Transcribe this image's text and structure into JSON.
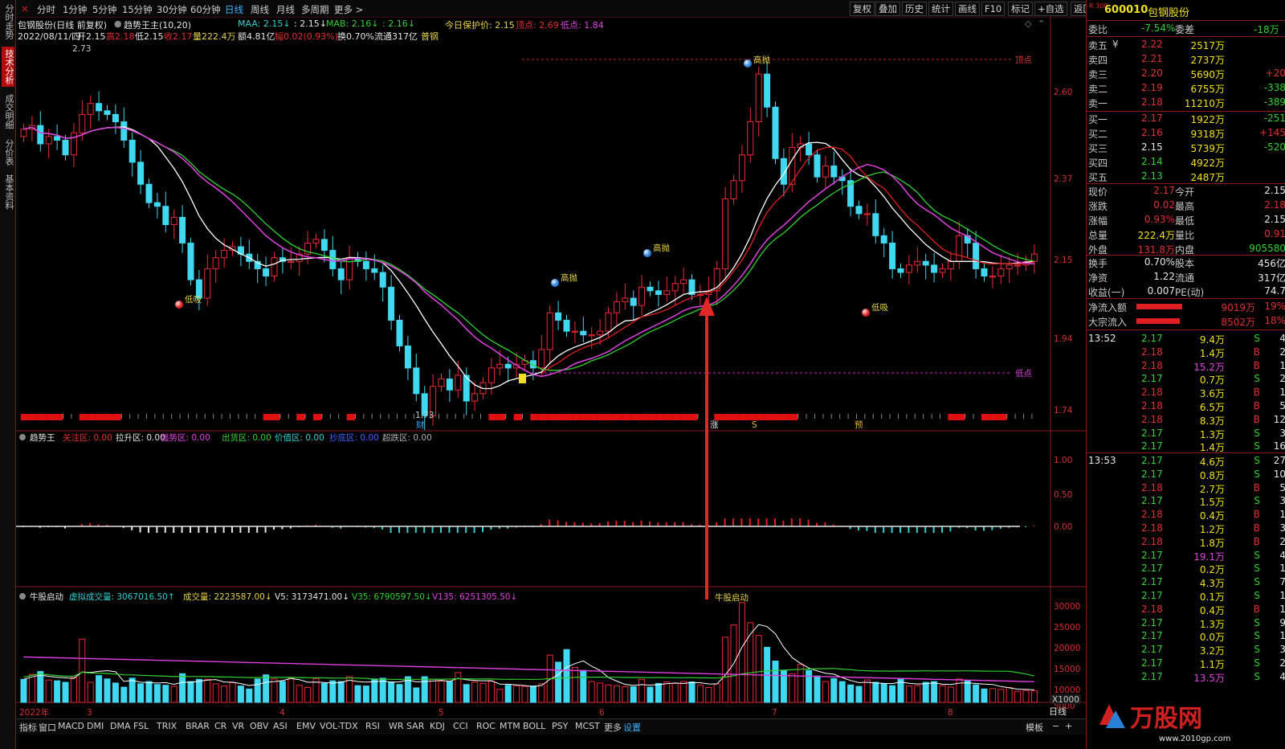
{
  "side_tabs": [
    "分时走势",
    "技术分析",
    "成交明细",
    "分价表",
    "基本资料"
  ],
  "periods": [
    "分时",
    "1分钟",
    "5分钟",
    "15分钟",
    "30分钟",
    "60分钟",
    "日线",
    "周线",
    "月线",
    "多周期",
    "更多 >"
  ],
  "tools": [
    "复权",
    "叠加",
    "历史",
    "统计",
    "画线",
    "F10",
    "标记",
    "+自选",
    "返回"
  ],
  "info": {
    "title": "包钢股份(日线 前复权)",
    "indicator": "趋势王主(10,20)",
    "maa": "MAA: 2.15↓",
    "mid": ": 2.15↓",
    "mab": "MAB: 2.16↓",
    "mac": ": 2.16↓",
    "protect": "今日保护价: 2.15",
    "top": "顶点: 2.69",
    "bottom": "低点: 1.84",
    "date": "2022/08/11/四",
    "open": "开2.15",
    "high": "高2.18",
    "low": "低2.15",
    "close": "收2.17",
    "vol": "量222.4万",
    "amt": "额4.81亿",
    "chg": "幅0.02(0.93%)",
    "turn": "换0.70%",
    "flow": "流通317亿",
    "cat": "普钢"
  },
  "price_axis": [
    "2.60",
    "2.37",
    "2.15",
    "1.94",
    "1.74"
  ],
  "annotations": {
    "high_mark": "2.73",
    "low_mark": "1.73",
    "top_label": "顶点",
    "bottom_label": "低点",
    "sell1": "高抛",
    "sell2": "高抛",
    "sell3": "高抛",
    "buy1": "低吸",
    "buy2": "低吸",
    "tag_cai": "财",
    "tag_zhang": "涨",
    "tag_s": "S",
    "tag_yu": "预"
  },
  "panel2": {
    "name": "趋势王",
    "items": [
      "关注区: 0.00",
      "拉升区: 0.00",
      "强势区: 0.00",
      "出货区: 0.00",
      "价值区: 0.00",
      "抄底区: 0.00",
      "超跌区: 0.00"
    ],
    "colors": [
      "#e03030",
      "#e6e6e6",
      "#e040e0",
      "#30d030",
      "#30d0d0",
      "#4060ff",
      "#b0b0b0"
    ],
    "axis": [
      "1.00",
      "0.50",
      "0.00"
    ]
  },
  "panel3": {
    "name": "牛股启动",
    "virt": "虚拟成交量: 3067016.50↑",
    "vol": "成交量: 2223587.00↓",
    "v5": "V5: 3173471.00↓",
    "v35": "V35: 6790597.50↓",
    "v135": "V135: 6251305.50↓",
    "axis": [
      "30000",
      "25000",
      "20000",
      "15000",
      "10000",
      "5000"
    ],
    "unit": "X1000",
    "marker": "牛股启动"
  },
  "date_axis": [
    "2022年",
    "3",
    "4",
    "5",
    "6",
    "7",
    "8"
  ],
  "bottom_tabs": [
    "指标",
    "窗口",
    "MACD",
    "DMI",
    "DMA",
    "FSL",
    "TRIX",
    "BRAR",
    "CR",
    "VR",
    "OBV",
    "ASI",
    "EMV",
    "VOL-TDX",
    "RSI",
    "WR",
    "SAR",
    "KDJ",
    "CCI",
    "ROC",
    "MTM",
    "BOLL",
    "PSY",
    "MCST",
    "更多",
    "设置"
  ],
  "bottom_right": [
    "日线",
    "模板"
  ],
  "stock": {
    "code": "600010",
    "name": "包钢股份",
    "badge": "R 300"
  },
  "wei": {
    "label1": "委比",
    "v1": "-7.54%",
    "label2": "委差",
    "v2": "-18万"
  },
  "sell_orders": [
    {
      "label": "卖五",
      "flag": "¥",
      "price": "2.22",
      "vol": "2517万",
      "chg": ""
    },
    {
      "label": "卖四",
      "flag": "",
      "price": "2.21",
      "vol": "2737万",
      "chg": ""
    },
    {
      "label": "卖三",
      "flag": "",
      "price": "2.20",
      "vol": "5690万",
      "chg": "+20"
    },
    {
      "label": "卖二",
      "flag": "",
      "price": "2.19",
      "vol": "6755万",
      "chg": "-338"
    },
    {
      "label": "卖一",
      "flag": "",
      "price": "2.18",
      "vol": "11210万",
      "chg": "-389"
    }
  ],
  "buy_orders": [
    {
      "label": "买一",
      "price": "2.17",
      "vol": "1922万",
      "chg": "-251"
    },
    {
      "label": "买二",
      "price": "2.16",
      "vol": "9318万",
      "chg": "+145"
    },
    {
      "label": "买三",
      "price": "2.15",
      "vol": "5739万",
      "chg": "-520"
    },
    {
      "label": "买四",
      "price": "2.14",
      "vol": "4922万",
      "chg": ""
    },
    {
      "label": "买五",
      "price": "2.13",
      "vol": "2487万",
      "chg": ""
    }
  ],
  "quote": [
    {
      "l1": "现价",
      "v1": "2.17",
      "l2": "今开",
      "v2": "2.15"
    },
    {
      "l1": "涨跌",
      "v1": "0.02",
      "l2": "最高",
      "v2": "2.18"
    },
    {
      "l1": "涨幅",
      "v1": "0.93%",
      "l2": "最低",
      "v2": "2.15"
    },
    {
      "l1": "总量",
      "v1": "222.4万",
      "l2": "量比",
      "v2": "0.91"
    },
    {
      "l1": "外盘",
      "v1": "131.8万",
      "l2": "内盘",
      "v2": "905580"
    }
  ],
  "fundamentals": [
    {
      "l1": "换手",
      "v1": "0.70%",
      "l2": "股本",
      "v2": "456亿"
    },
    {
      "l1": "净资",
      "v1": "1.22",
      "l2": "流通",
      "v2": "317亿"
    },
    {
      "l1": "收益(一)",
      "v1": "0.007",
      "l2": "PE(动)",
      "v2": "74.7"
    }
  ],
  "flows": [
    {
      "label": "净流入额",
      "value": "9019万",
      "pct": "19%",
      "fill": 0.95
    },
    {
      "label": "大宗流入",
      "value": "8502万",
      "pct": "18%",
      "fill": 0.9
    }
  ],
  "ticks_1": {
    "time": "13:52",
    "rows": [
      [
        "2.17",
        "9.4万",
        "S",
        "4"
      ],
      [
        "2.18",
        "1.4万",
        "B",
        "2"
      ],
      [
        "2.18",
        "15.2万",
        "B",
        "1"
      ],
      [
        "2.17",
        "0.7万",
        "S",
        "2"
      ],
      [
        "2.18",
        "3.6万",
        "B",
        "1"
      ],
      [
        "2.18",
        "6.5万",
        "B",
        "5"
      ],
      [
        "2.18",
        "8.3万",
        "B",
        "12"
      ],
      [
        "2.17",
        "1.3万",
        "S",
        "3"
      ],
      [
        "2.17",
        "1.4万",
        "S",
        "16"
      ]
    ]
  },
  "ticks_2": {
    "time": "13:53",
    "rows": [
      [
        "2.17",
        "4.6万",
        "S",
        "27"
      ],
      [
        "2.17",
        "0.8万",
        "S",
        "10"
      ],
      [
        "2.18",
        "2.7万",
        "B",
        "5"
      ],
      [
        "2.17",
        "1.5万",
        "S",
        "3"
      ],
      [
        "2.18",
        "0.4万",
        "B",
        "1"
      ],
      [
        "2.18",
        "1.2万",
        "B",
        "3"
      ],
      [
        "2.18",
        "1.8万",
        "B",
        "2"
      ],
      [
        "2.17",
        "19.1万",
        "S",
        "4"
      ],
      [
        "2.17",
        "0.2万",
        "S",
        "1"
      ],
      [
        "2.17",
        "4.3万",
        "S",
        "7"
      ],
      [
        "2.17",
        "0.1万",
        "S",
        "1"
      ],
      [
        "2.18",
        "0.4万",
        "B",
        "1"
      ],
      [
        "2.17",
        "1.3万",
        "S",
        "9"
      ],
      [
        "2.17",
        "0.0万",
        "S",
        "1"
      ],
      [
        "2.17",
        "3.2万",
        "S",
        "3"
      ],
      [
        "2.17",
        "1.1万",
        "S",
        "2"
      ],
      [
        "2.17",
        "13.5万",
        "S",
        "4"
      ]
    ]
  },
  "chart_data": {
    "type": "candlestick",
    "x_start": "2022-02",
    "x_end": "2022-08-11",
    "ylim": [
      1.7,
      2.75
    ],
    "closes": [
      2.51,
      2.52,
      2.47,
      2.49,
      2.48,
      2.44,
      2.5,
      2.55,
      2.58,
      2.56,
      2.55,
      2.53,
      2.48,
      2.42,
      2.36,
      2.31,
      2.3,
      2.25,
      2.27,
      2.2,
      2.1,
      2.05,
      2.13,
      2.16,
      2.18,
      2.19,
      2.17,
      2.15,
      2.13,
      2.11,
      2.16,
      2.15,
      2.15,
      2.17,
      2.2,
      2.21,
      2.18,
      2.13,
      2.1,
      2.16,
      2.15,
      2.13,
      2.12,
      2.08,
      1.99,
      1.92,
      1.86,
      1.79,
      1.73,
      1.81,
      1.83,
      1.8,
      1.84,
      1.77,
      1.79,
      1.82,
      1.86,
      1.87,
      1.86,
      1.87,
      1.88,
      1.86,
      1.91,
      2.01,
      1.99,
      1.96,
      1.96,
      1.95,
      1.95,
      1.96,
      2.01,
      2.04,
      2.05,
      2.03,
      2.08,
      2.07,
      2.06,
      2.07,
      2.09,
      2.1,
      2.06,
      2.06,
      2.07,
      2.13,
      2.32,
      2.37,
      2.44,
      2.53,
      2.66,
      2.57,
      2.43,
      2.36,
      2.46,
      2.47,
      2.44,
      2.38,
      2.41,
      2.38,
      2.37,
      2.3,
      2.28,
      2.28,
      2.22,
      2.2,
      2.13,
      2.12,
      2.14,
      2.15,
      2.14,
      2.12,
      2.13,
      2.15,
      2.22,
      2.2,
      2.13,
      2.11,
      2.11,
      2.13,
      2.14,
      2.14,
      2.15,
      2.17
    ],
    "series": [
      {
        "name": "MAA",
        "color": "#ffffff"
      },
      {
        "name": "MAB",
        "color": "#30d030"
      },
      {
        "name": "V5",
        "color": "#ffffff"
      },
      {
        "name": "V35",
        "color": "#30d030"
      },
      {
        "name": "V135",
        "color": "#e040e0"
      }
    ],
    "volume_ylim": [
      0,
      30000
    ],
    "volume": [
      6200,
      7500,
      8300,
      6000,
      5800,
      5400,
      6700,
      17000,
      5400,
      7200,
      6300,
      5200,
      4100,
      6500,
      5000,
      5600,
      4800,
      4600,
      4300,
      7700,
      5600,
      6200,
      6200,
      5000,
      4400,
      5300,
      4400,
      3600,
      6300,
      7400,
      6300,
      5600,
      6600,
      4600,
      4000,
      6400,
      5100,
      5800,
      5600,
      6900,
      4500,
      4400,
      6300,
      6500,
      5500,
      4800,
      6900,
      3900,
      6900,
      6200,
      5700,
      5600,
      8000,
      4800,
      5500,
      5100,
      5700,
      3500,
      4600,
      4500,
      4300,
      4400,
      5000,
      12700,
      10800,
      14200,
      9400,
      8600,
      5600,
      5200,
      4700,
      4500,
      4200,
      4200,
      6200,
      4100,
      5100,
      5500,
      5100,
      5600,
      5500,
      4600,
      4000,
      5000,
      17500,
      20800,
      26800,
      21400,
      18000,
      14800,
      11100,
      8600,
      7700,
      10200,
      8600,
      7100,
      5600,
      6400,
      5600,
      4700,
      4300,
      6000,
      5400,
      5100,
      4500,
      6200,
      4400,
      4500,
      5400,
      5600,
      4500,
      4100,
      6300,
      5800,
      4700,
      3600,
      3700,
      3500,
      4000,
      3000,
      3200,
      3100
    ]
  }
}
